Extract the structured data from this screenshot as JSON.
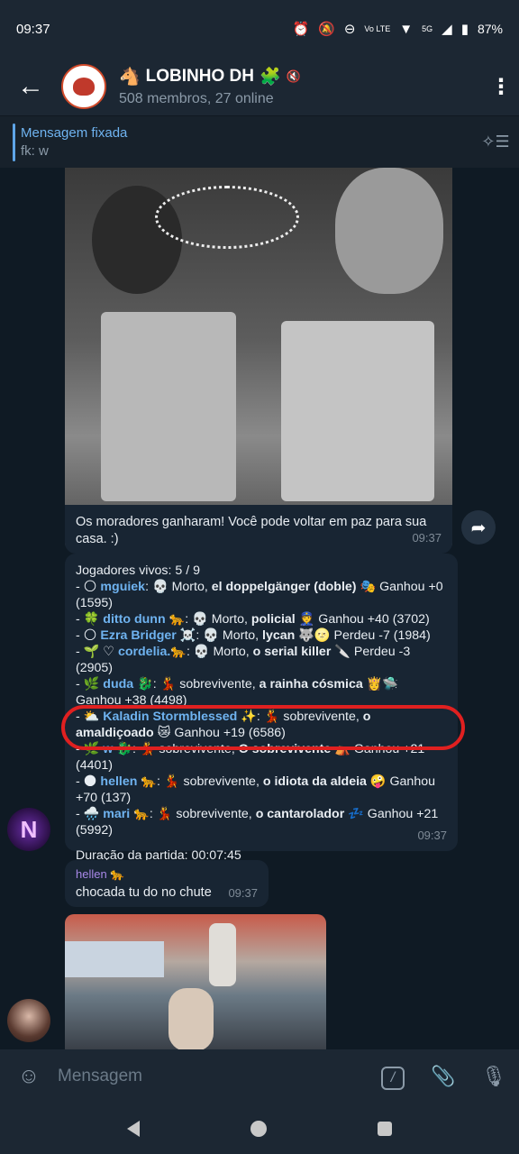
{
  "status": {
    "time": "09:37",
    "battery": "87%",
    "network": "5G"
  },
  "header": {
    "title": "LOBINHO DH",
    "subtitle": "508 membros, 27 online",
    "back_icon": "arrow-left-icon",
    "more_icon": "more-vertical-icon"
  },
  "pinned": {
    "title": "Mensagem fixada",
    "text": "fk: w"
  },
  "messages": {
    "m1": {
      "caption": "Os moradores ganharam! Você pode voltar em paz para sua casa. :)",
      "time": "09:37"
    },
    "m2": {
      "header": "Jogadores vivos: 5 / 9",
      "players": [
        {
          "name": "mguiek",
          "pre": "- 🌕 ",
          "mid": ": 💀 Morto, ",
          "role": "el doppelgänger (doble)",
          "post": " 🎭 Ganhou +0 (1595)"
        },
        {
          "name": "ditto dunn 🐆",
          "pre": "- 🍀 ",
          "mid": ": 💀 Morto, ",
          "role": "policial",
          "post": " 👮 Ganhou +40 (3702)"
        },
        {
          "name": "Ezra Bridger ☠️",
          "pre": "- 🌕 ",
          "mid": ": 💀 Morto, ",
          "role": "lycan",
          "post": " 🐺🌝 Perdeu -7 (1984)"
        },
        {
          "name": "cordelia.🐆",
          "pre": "- 🌱 ♡ ",
          "mid": ": 💀 Morto, ",
          "role": "o serial killer",
          "post": " 🔪 Perdeu -3 (2905)"
        },
        {
          "name": "duda 🐉",
          "pre": "- 🌿 ",
          "mid": ": 💃 sobrevivente, ",
          "role": "a rainha cósmica",
          "post": " 👸🛸 Ganhou +38 (4498)"
        },
        {
          "name": "Kaladin Stormblessed ✨",
          "pre": "- ⛅ ",
          "mid": ": 💃 sobrevivente, ",
          "role": "o amaldiçoado",
          "post": " 😿 Ganhou +19 (6586)"
        },
        {
          "name": "w 🐉",
          "pre": "- 🌿 ",
          "mid": ": 💃 sobrevivente, ",
          "role": "O sobrevivente",
          "post": " ⛺ Ganhou +21 (4401)"
        },
        {
          "name": "hellen 🐆",
          "pre": "- 🌑 ",
          "mid": ": 💃 sobrevivente, ",
          "role": "o idiota da aldeia",
          "post": " 🤪 Ganhou +70 (137)"
        },
        {
          "name": "mari 🐆",
          "pre": "- 🌧️ ",
          "mid": ": 💃 sobrevivente, ",
          "role": "o cantarolador",
          "post": " 💤 Ganhou +21 (5992)"
        }
      ],
      "duration": "Duração da partida: 00:07:45",
      "time": "09:37"
    },
    "m3": {
      "sender": "hellen 🐆",
      "text": "chocada tu do no chute",
      "time": "09:37"
    }
  },
  "input": {
    "placeholder": "Mensagem"
  },
  "colors": {
    "accent": "#6fb3f0",
    "highlight": "#e02020",
    "bubble": "#182533"
  }
}
